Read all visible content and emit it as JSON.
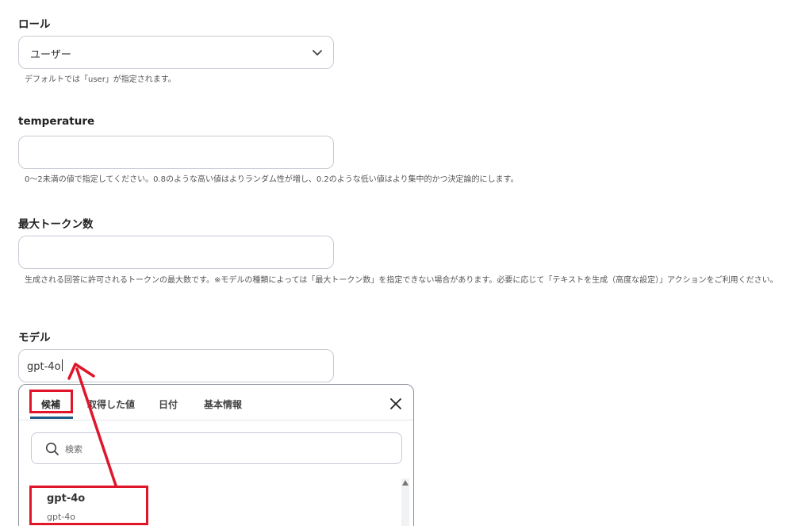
{
  "role": {
    "label": "ロール",
    "value": "ユーザー",
    "help": "デフォルトでは「user」が指定されます。"
  },
  "temperature": {
    "label": "temperature",
    "value": "",
    "help": "0〜2未満の値で指定してください。0.8のような高い値はよりランダム性が増し、0.2のような低い値はより集中的かつ決定論的にします。"
  },
  "max_tokens": {
    "label": "最大トークン数",
    "value": "",
    "help": "生成される回答に許可されるトークンの最大数です。※モデルの種類によっては「最大トークン数」を指定できない場合があります。必要に応じて「テキストを生成（高度な設定）」アクションをご利用ください。"
  },
  "model": {
    "label": "モデル",
    "value": "gpt-4o"
  },
  "dropdown": {
    "tabs": [
      "候補",
      "取得した値",
      "日付",
      "基本情報"
    ],
    "active_tab": "候補",
    "search_placeholder": "検索",
    "options": [
      {
        "title": "gpt-4o",
        "subtitle": "gpt-4o"
      }
    ]
  },
  "colors": {
    "annotation": "#e0152a",
    "tab_active_underline": "#1d5c83"
  }
}
